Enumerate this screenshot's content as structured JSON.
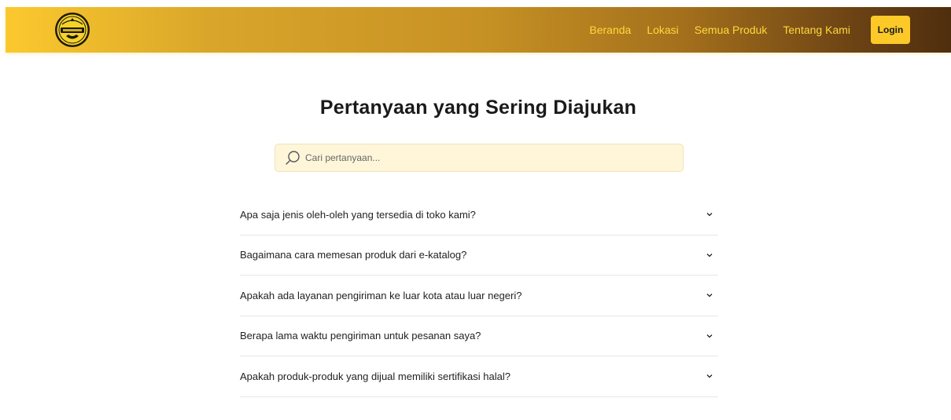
{
  "header": {
    "logo_icon": "brand-logo-emblem",
    "nav": [
      {
        "label": "Beranda"
      },
      {
        "label": "Lokasi"
      },
      {
        "label": "Semua Produk"
      },
      {
        "label": "Tentang Kami"
      }
    ],
    "login_label": "Login"
  },
  "main": {
    "title": "Pertanyaan yang Sering Diajukan",
    "search": {
      "placeholder": "Cari pertanyaan...",
      "value": "",
      "icon": "search-icon"
    },
    "faq": [
      {
        "question": "Apa saja jenis oleh-oleh yang tersedia di toko kami?"
      },
      {
        "question": "Bagaimana cara memesan produk dari e-katalog?"
      },
      {
        "question": "Apakah ada layanan pengiriman ke luar kota atau luar negeri?"
      },
      {
        "question": "Berapa lama waktu pengiriman untuk pesanan saya?"
      },
      {
        "question": "Apakah produk-produk yang dijual memiliki sertifikasi halal?"
      }
    ],
    "expand_icon": "chevron-down-icon"
  },
  "colors": {
    "nav_gradient_start": "#fbc92e",
    "nav_gradient_end": "#4f2e0e",
    "nav_link": "#ffd93a",
    "login_button": "#fdc928",
    "search_background": "#fff6da"
  }
}
